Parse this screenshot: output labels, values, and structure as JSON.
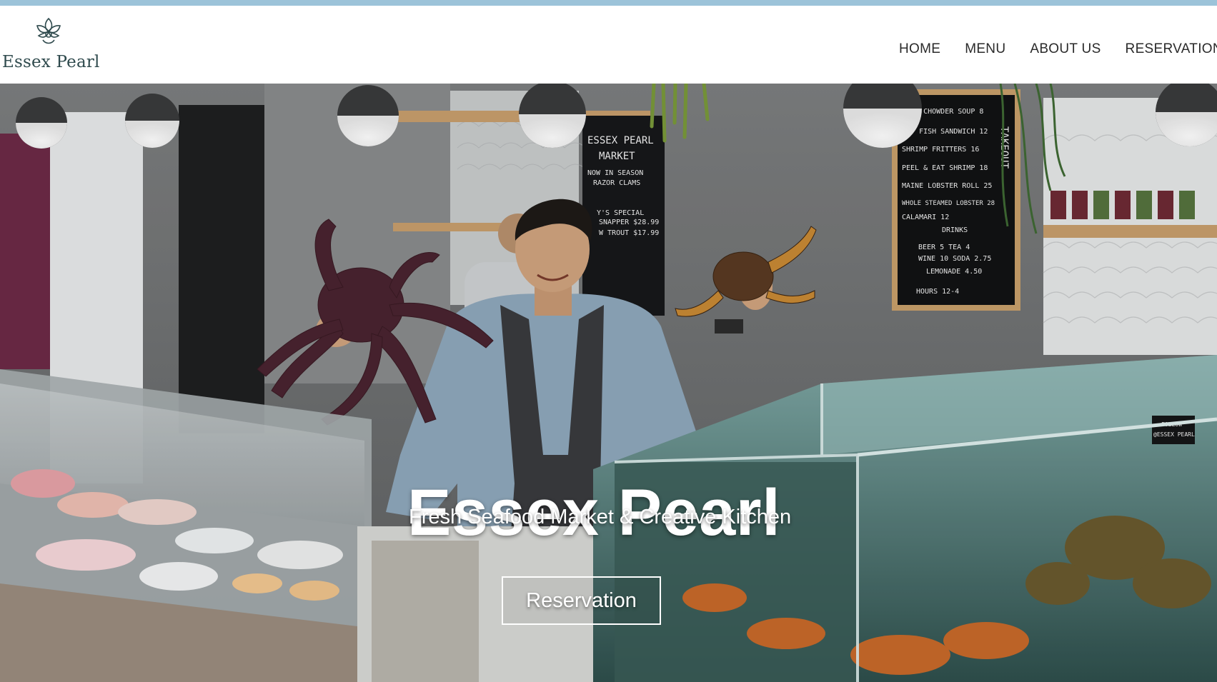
{
  "brand": {
    "name": "Essex Pearl",
    "logo_icon": "pearl-shell-icon",
    "color": "#2f4a4d"
  },
  "nav": {
    "items": [
      {
        "label": "HOME"
      },
      {
        "label": "MENU"
      },
      {
        "label": "ABOUT US"
      },
      {
        "label": "RESERVATION"
      }
    ]
  },
  "hero": {
    "title": "Essex Pearl",
    "subtitle": "Fresh Seafood Market & Creative Kitchen",
    "cta_label": "Reservation",
    "photo": {
      "menu_board": {
        "items": [
          "CLAM CHOWDER SOUP 8",
          "HOT FISH SANDWICH 12",
          "SHRIMP FRITTERS 16",
          "PEEL & EAT SHRIMP 18",
          "MAINE LOBSTER ROLL 25",
          "WHOLE STEAMED LOBSTER 28",
          "CALAMARI 12",
          "DRINKS",
          "BEER 5   TEA 4",
          "WINE 10   SODA 2.75",
          "LEMONADE 4.50",
          "HOURS 12-4"
        ],
        "side_label": "TAKEOUT"
      },
      "market_board": {
        "lines": [
          "ESSEX PEARL",
          "MARKET",
          "NOW IN SEASON",
          "RAZOR CLAMS",
          "Y'S SPECIAL",
          "SNAPPER $28.99",
          "W TROUT $17.99"
        ]
      },
      "tank_sign": {
        "lines": [
          "FOLLOW",
          "@ESSEX PEARL"
        ]
      }
    }
  },
  "colors": {
    "top_strip": "#9cc3d9",
    "accent": "#2f4a4d"
  }
}
